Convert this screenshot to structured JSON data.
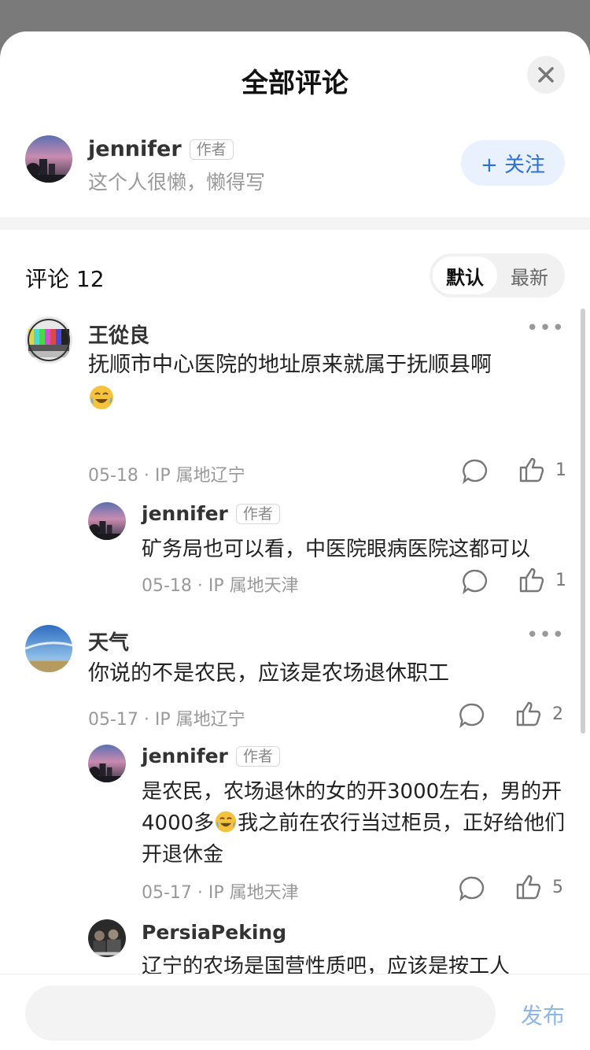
{
  "header": {
    "title": "全部评论"
  },
  "author": {
    "name": "jennifer",
    "badge": "作者",
    "bio": "这个人很懒，懒得写",
    "follow_label": "+ 关注"
  },
  "comments_header": {
    "title": "评论 12",
    "sort_default": "默认",
    "sort_latest": "最新"
  },
  "comments": [
    {
      "name": "王從良",
      "text": "抚顺市中心医院的地址原来就属于抚顺县啊",
      "meta": "05-18 · IP 属地辽宁",
      "likes": "1",
      "reply": {
        "name": "jennifer",
        "badge": "作者",
        "text": "矿务局也可以看，中医院眼病医院这都可以",
        "meta": "05-18 · IP 属地天津",
        "likes": "1"
      }
    },
    {
      "name": "天气",
      "text": "你说的不是农民，应该是农场退休职工",
      "meta": "05-17 · IP 属地辽宁",
      "likes": "2",
      "replies": [
        {
          "name": "jennifer",
          "badge": "作者",
          "text_a": "是农民，农场退休的女的开3000左右，男的开4000多",
          "text_b": "我之前在农行当过柜员，正好给他们开退休金",
          "meta": "05-17 · IP 属地天津",
          "likes": "5"
        },
        {
          "name": "PersiaPeking",
          "text": "辽宁的农场是国营性质吧，应该是按工人"
        }
      ]
    }
  ],
  "composer": {
    "placeholder": "",
    "send_label": "发布"
  },
  "colors": {
    "accent": "#2a6fdb",
    "follow_bg": "#e8f1fd",
    "send": "#8db6ea"
  }
}
